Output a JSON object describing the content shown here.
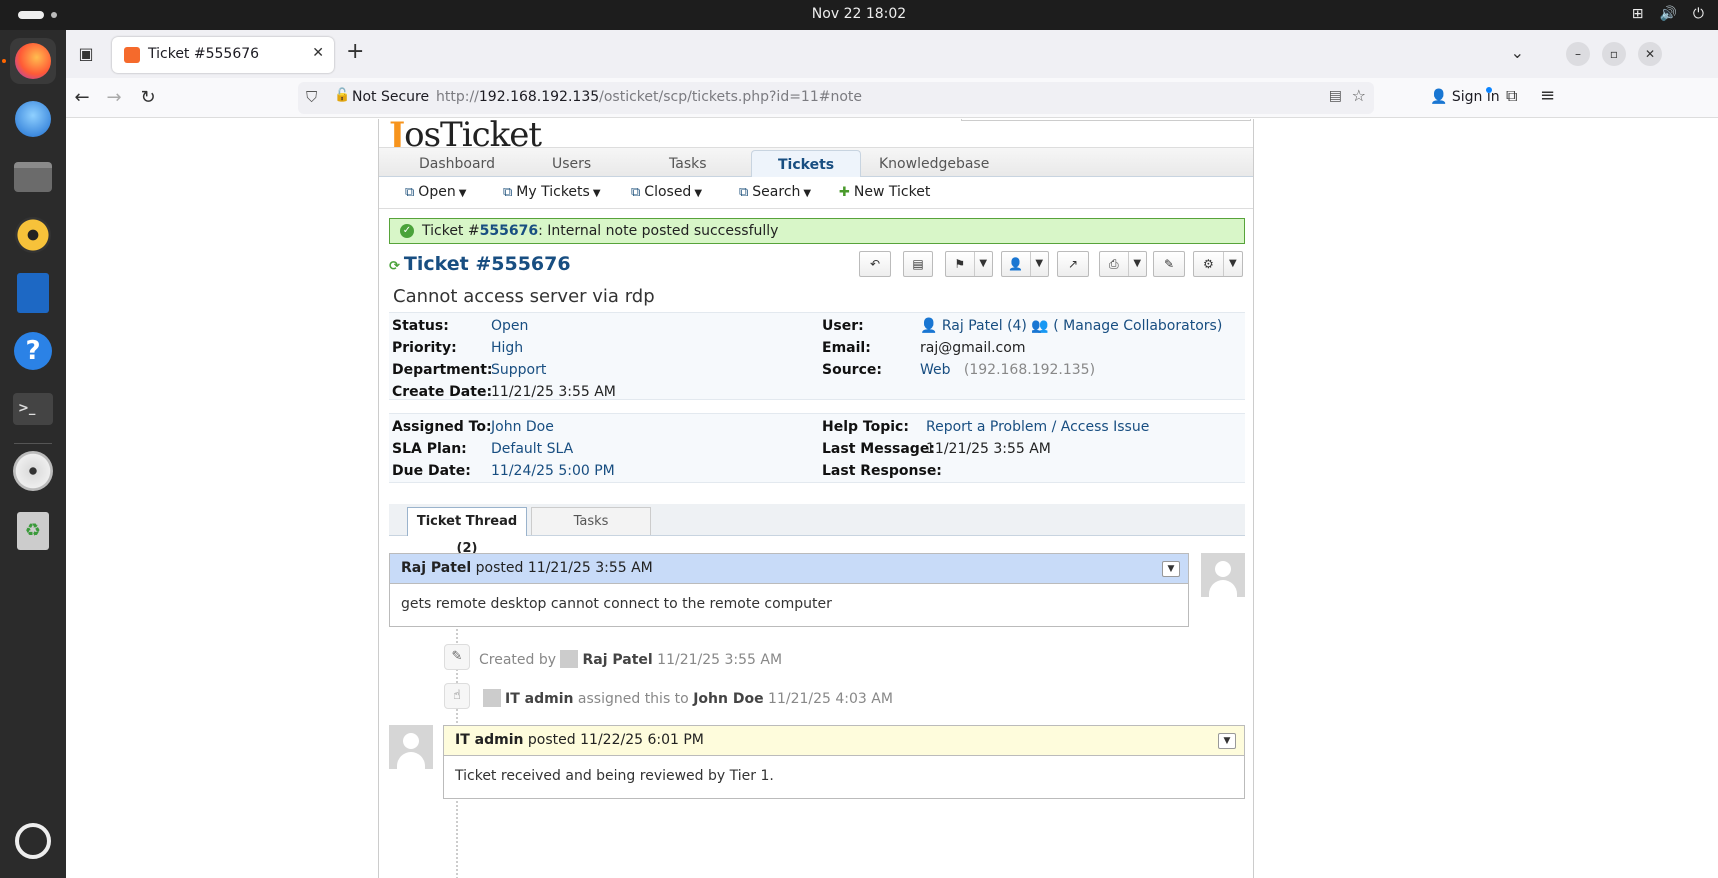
{
  "system": {
    "clock": "Nov 22  18:02"
  },
  "browser": {
    "tab_title": "Ticket #555676",
    "not_secure": "Not Secure",
    "url_prefix": "http://",
    "url_host": "192.168.192.135",
    "url_path": "/osticket/scp/tickets.php?id=11#note",
    "sign_in": "Sign in"
  },
  "app": {
    "logo_text": "osTicket",
    "nav": [
      "Dashboard",
      "Users",
      "Tasks",
      "Tickets",
      "Knowledgebase"
    ],
    "active_nav": "Tickets",
    "subnav": {
      "open": "Open",
      "my_tickets": "My Tickets",
      "closed": "Closed",
      "search": "Search",
      "new_ticket": "New Ticket"
    }
  },
  "notice": {
    "prefix": "Ticket #",
    "ticket_number": "555676",
    "message": ": Internal note posted successfully"
  },
  "ticket": {
    "title": "Ticket #555676",
    "subject": "Cannot access server via rdp",
    "labels": {
      "status": "Status:",
      "priority": "Priority:",
      "department": "Department:",
      "create_date": "Create Date:",
      "user": "User:",
      "email": "Email:",
      "source": "Source:",
      "assigned_to": "Assigned To:",
      "sla_plan": "SLA Plan:",
      "due_date": "Due Date:",
      "help_topic": "Help Topic:",
      "last_message": "Last Message:",
      "last_response": "Last Response:"
    },
    "status": "Open",
    "priority": "High",
    "department": "Support",
    "create_date": "11/21/25 3:55 AM",
    "user": "Raj Patel (4)",
    "manage_collaborators": "( Manage Collaborators)",
    "email": "raj@gmail.com",
    "source": "Web",
    "source_ip": "(192.168.192.135)",
    "assigned_to": "John Doe",
    "sla_plan": "Default SLA",
    "due_date": "11/24/25 5:00 PM",
    "help_topic": "Report a Problem / Access Issue",
    "last_message": "11/21/25 3:55 AM",
    "last_response": ""
  },
  "thread": {
    "tabs": [
      "Ticket Thread (2)",
      "Tasks"
    ],
    "entries": [
      {
        "author": "Raj Patel",
        "posted": "posted",
        "time": "11/21/25 3:55 AM",
        "body": "gets remote desktop cannot connect to the remote computer",
        "color": "#c8dbf8"
      },
      {
        "author": "IT admin",
        "posted": "posted",
        "time": "11/22/25 6:01 PM",
        "body": "Ticket received and being reviewed by Tier 1.",
        "color": "#fefcdc"
      }
    ],
    "events": [
      {
        "prefix": "Created by",
        "actor": "Raj Patel",
        "time": "11/21/25 3:55 AM"
      },
      {
        "actor": "IT admin",
        "action": "assigned this to",
        "target": "John Doe",
        "time": "11/21/25 4:03 AM"
      }
    ]
  }
}
